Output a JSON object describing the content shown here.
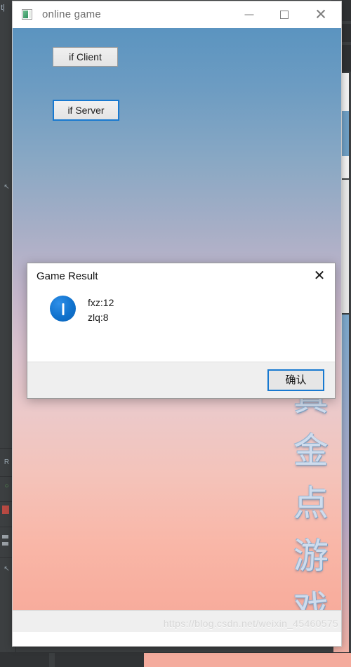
{
  "ide": {
    "toolbar_text": "t|",
    "left_icons": [
      {
        "name": "cursor-arrow-icon",
        "glyph": "↖"
      },
      {
        "name": "structure-letter-icon",
        "glyph": "R"
      },
      {
        "name": "run-icon",
        "glyph": "○"
      },
      {
        "name": "pointer-icon",
        "glyph": "↖"
      }
    ]
  },
  "window": {
    "title": "online game",
    "icon": "app-window-icon",
    "controls": {
      "minimize": "—",
      "maximize": "□",
      "close": "✕"
    }
  },
  "main": {
    "buttons": [
      {
        "id": "if-client",
        "label": "if Client",
        "focused": false
      },
      {
        "id": "if-server",
        "label": "if Server",
        "focused": true
      }
    ],
    "vertical_text": [
      "真",
      "金",
      "点",
      "游",
      "戏"
    ],
    "watermark": "https://blog.csdn.net/weixin_45460575"
  },
  "dialog": {
    "title": "Game Result",
    "close_glyph": "✕",
    "icon": "info-icon",
    "messages": [
      "fxz:12",
      "zlq:8"
    ],
    "ok_label": "确认"
  },
  "colors": {
    "focus_blue": "#1879d0",
    "info_blue": "#0f72cd",
    "sky_top": "#5b94c0",
    "sky_mid": "#dcc3ce",
    "sky_bottom": "#f5a99a",
    "title_text": "#6f6f6f"
  }
}
